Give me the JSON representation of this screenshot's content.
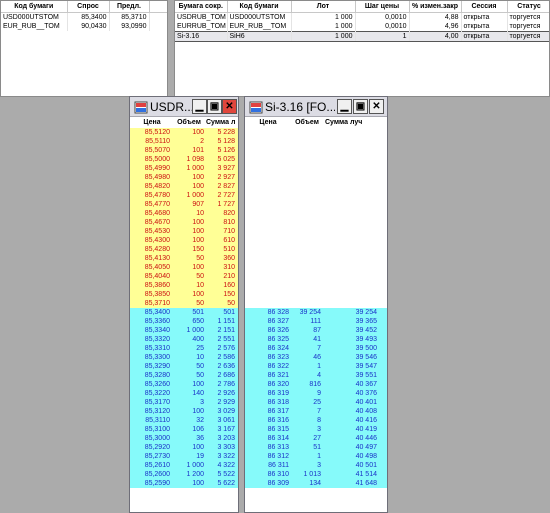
{
  "left_table": {
    "headers": [
      "Код бумаги",
      "Спрос",
      "Предл."
    ],
    "rows": [
      [
        "USD000UTSTOM",
        "85,3400",
        "85,3710"
      ],
      [
        "EUR_RUB__TOM",
        "90,0430",
        "93,0990"
      ]
    ]
  },
  "right_table": {
    "headers": [
      "Бумага сокр.",
      "Код бумаги",
      "Лот",
      "Шаг цены",
      "% измен.закр",
      "Сессия",
      "Статус"
    ],
    "rows": [
      [
        "USDRUB_TOM",
        "USD000UTSTOM",
        "1 000",
        "0,0010",
        "4,88",
        "открыта",
        "торгуется"
      ],
      [
        "EURRUB_TOM",
        "EUR_RUB__TOM",
        "1 000",
        "0,0010",
        "4,96",
        "открыта",
        "торгуется"
      ],
      [
        "Si-3.16",
        "SiH6",
        "1 000",
        "1",
        "4,00",
        "открыта",
        "торгуется"
      ]
    ]
  },
  "orderbook_usd": {
    "title": "USDR...",
    "headers": [
      "Цена",
      "Объем",
      "Сумма л"
    ],
    "asks": [
      [
        "85,5120",
        "100",
        "5 228"
      ],
      [
        "85,5110",
        "2",
        "5 128"
      ],
      [
        "85,5070",
        "101",
        "5 126"
      ],
      [
        "85,5000",
        "1 098",
        "5 025"
      ],
      [
        "85,4990",
        "1 000",
        "3 927"
      ],
      [
        "85,4980",
        "100",
        "2 927"
      ],
      [
        "85,4820",
        "100",
        "2 827"
      ],
      [
        "85,4780",
        "1 000",
        "2 727"
      ],
      [
        "85,4770",
        "907",
        "1 727"
      ],
      [
        "85,4680",
        "10",
        "820"
      ],
      [
        "85,4670",
        "100",
        "810"
      ],
      [
        "85,4530",
        "100",
        "710"
      ],
      [
        "85,4300",
        "100",
        "610"
      ],
      [
        "85,4280",
        "150",
        "510"
      ],
      [
        "85,4130",
        "50",
        "360"
      ],
      [
        "85,4050",
        "100",
        "310"
      ],
      [
        "85,4040",
        "50",
        "210"
      ],
      [
        "85,3860",
        "10",
        "160"
      ],
      [
        "85,3850",
        "100",
        "150"
      ],
      [
        "85,3710",
        "50",
        "50"
      ]
    ],
    "bids": [
      [
        "85,3400",
        "501",
        "501"
      ],
      [
        "85,3360",
        "650",
        "1 151"
      ],
      [
        "85,3340",
        "1 000",
        "2 151"
      ],
      [
        "85,3320",
        "400",
        "2 551"
      ],
      [
        "85,3310",
        "25",
        "2 576"
      ],
      [
        "85,3300",
        "10",
        "2 586"
      ],
      [
        "85,3290",
        "50",
        "2 636"
      ],
      [
        "85,3280",
        "50",
        "2 686"
      ],
      [
        "85,3260",
        "100",
        "2 786"
      ],
      [
        "85,3220",
        "140",
        "2 926"
      ],
      [
        "85,3170",
        "3",
        "2 929"
      ],
      [
        "85,3120",
        "100",
        "3 029"
      ],
      [
        "85,3110",
        "32",
        "3 061"
      ],
      [
        "85,3100",
        "106",
        "3 167"
      ],
      [
        "85,3000",
        "36",
        "3 203"
      ],
      [
        "85,2920",
        "100",
        "3 303"
      ],
      [
        "85,2730",
        "19",
        "3 322"
      ],
      [
        "85,2610",
        "1 000",
        "4 322"
      ],
      [
        "85,2600",
        "1 200",
        "5 522"
      ],
      [
        "85,2590",
        "100",
        "5 622"
      ]
    ]
  },
  "orderbook_si": {
    "title": "Si-3.16 [FO...",
    "headers": [
      "Цена",
      "Объем",
      "Сумма луч"
    ],
    "bids": [
      [
        "86 328",
        "39 254",
        "39 254"
      ],
      [
        "86 327",
        "111",
        "39 365"
      ],
      [
        "86 326",
        "87",
        "39 452"
      ],
      [
        "86 325",
        "41",
        "39 493"
      ],
      [
        "86 324",
        "7",
        "39 500"
      ],
      [
        "86 323",
        "46",
        "39 546"
      ],
      [
        "86 322",
        "1",
        "39 547"
      ],
      [
        "86 321",
        "4",
        "39 551"
      ],
      [
        "86 320",
        "816",
        "40 367"
      ],
      [
        "86 319",
        "9",
        "40 376"
      ],
      [
        "86 318",
        "25",
        "40 401"
      ],
      [
        "86 317",
        "7",
        "40 408"
      ],
      [
        "86 316",
        "8",
        "40 416"
      ],
      [
        "86 315",
        "3",
        "40 419"
      ],
      [
        "86 314",
        "27",
        "40 446"
      ],
      [
        "86 313",
        "51",
        "40 497"
      ],
      [
        "86 312",
        "1",
        "40 498"
      ],
      [
        "86 311",
        "3",
        "40 501"
      ],
      [
        "86 310",
        "1 013",
        "41 514"
      ],
      [
        "86 309",
        "134",
        "41 648"
      ]
    ]
  }
}
